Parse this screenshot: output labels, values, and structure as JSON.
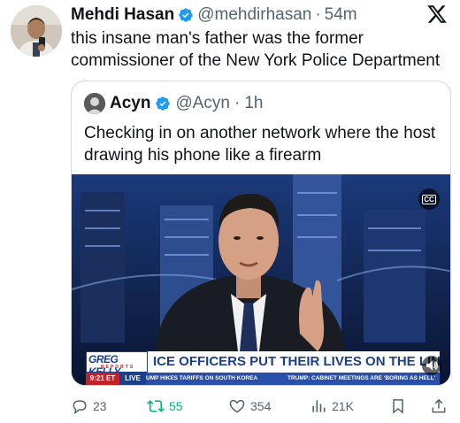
{
  "tweet": {
    "author_name": "Mehdi Hasan",
    "author_handle": "@mehdirhasan",
    "separator": "·",
    "time": "54m",
    "text": "this insane man's father was the former commissioner of the New York Police Department"
  },
  "quote": {
    "author_name": "Acyn",
    "author_handle": "@Acyn",
    "separator": "·",
    "time": "1h",
    "text": "Checking in on another network where the host drawing his phone like a firearm",
    "video": {
      "cc_label": "CC",
      "logo_text": "GREG KELLY",
      "logo_sub": "REPORTS",
      "headline": "ICE OFFICERS PUT THEIR LIVES ON THE LINE",
      "clock": "9:21 ET",
      "live_label": "LIVE",
      "ticker_1": "UMP HIKES TARIFFS ON SOUTH KOREA",
      "ticker_2": "TRUMP: CABINET MEETINGS ARE 'BORING AS HELL'"
    }
  },
  "actions": {
    "replies": "23",
    "retweets": "55",
    "likes": "354",
    "views": "21K"
  },
  "colors": {
    "text": "#0f1419",
    "secondary": "#536471",
    "verified": "#1d9bf0",
    "retweet": "#00ba7c",
    "border": "#cfd9de"
  },
  "icons": [
    "x-logo-icon",
    "verified-badge-icon",
    "reply-icon",
    "retweet-icon",
    "like-icon",
    "views-icon",
    "bookmark-icon",
    "share-icon",
    "cc-icon",
    "sound-icon"
  ]
}
